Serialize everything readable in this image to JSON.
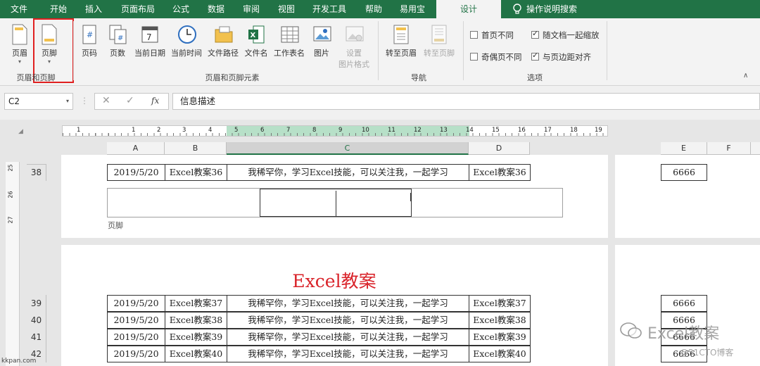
{
  "tabs": [
    "文件",
    "开始",
    "插入",
    "页面布局",
    "公式",
    "数据",
    "审阅",
    "视图",
    "开发工具",
    "帮助",
    "易用宝",
    "设计"
  ],
  "tell_me": "操作说明搜索",
  "ribbon": {
    "header_footer_group": {
      "label": "页眉和页脚",
      "header": "页眉",
      "footer": "页脚"
    },
    "elements_group": {
      "label": "页眉和页脚元素",
      "buttons": [
        "页码",
        "页数",
        "当前日期",
        "当前时间",
        "文件路径",
        "文件名",
        "工作表名",
        "图片"
      ],
      "format_picture_line1": "设置",
      "format_picture_line2": "图片格式"
    },
    "nav_group": {
      "label": "导航",
      "goto_header": "转至页眉",
      "goto_footer": "转至页脚"
    },
    "options_group": {
      "label": "选项",
      "first_page": "首页不同",
      "odd_even": "奇偶页不同",
      "scale_with_doc": "随文档一起缩放",
      "align_margins": "与页边距对齐"
    }
  },
  "formula_bar": {
    "name_box": "C2",
    "formula": "信息描述",
    "cancel": "✕",
    "enter": "✓",
    "fx": "fx"
  },
  "ruler_numbers": [
    "1",
    "1",
    "2",
    "3",
    "4",
    "5",
    "6",
    "7",
    "8",
    "9",
    "10",
    "11",
    "12",
    "13",
    "14",
    "15",
    "16",
    "17",
    "18",
    "19"
  ],
  "columns": [
    "A",
    "B",
    "C",
    "D",
    "E",
    "F"
  ],
  "footer_label": "页脚",
  "page_title": "Excel教案",
  "rows": [
    {
      "num": "38",
      "date": "2019/5/20",
      "b": "Excel教案36",
      "c": "我稀罕你，学习Excel技能，可以关注我，一起学习",
      "d": "Excel教案36",
      "e": "6666"
    },
    {
      "num": "39",
      "date": "2019/5/20",
      "b": "Excel教案37",
      "c": "我稀罕你，学习Excel技能，可以关注我，一起学习",
      "d": "Excel教案37",
      "e": "6666"
    },
    {
      "num": "40",
      "date": "2019/5/20",
      "b": "Excel教案38",
      "c": "我稀罕你，学习Excel技能，可以关注我，一起学习",
      "d": "Excel教案38",
      "e": "6666"
    },
    {
      "num": "41",
      "date": "2019/5/20",
      "b": "Excel教案39",
      "c": "我稀罕你，学习Excel技能，可以关注我，一起学习",
      "d": "Excel教案39",
      "e": "6666"
    },
    {
      "num": "42",
      "date": "2019/5/20",
      "b": "Excel教案40",
      "c": "我稀罕你，学习Excel技能，可以关注我，一起学习",
      "d": "Excel教案40",
      "e": "6666"
    }
  ],
  "vruler_marks": [
    "25",
    "26",
    "27"
  ],
  "watermark": "Excel教案",
  "watermark_sub": "@51CTO博客",
  "site_mark": "kkpan.com",
  "colors": {
    "accent": "#217346",
    "title_red": "#d9232a",
    "highlight_box": "#e02020"
  }
}
